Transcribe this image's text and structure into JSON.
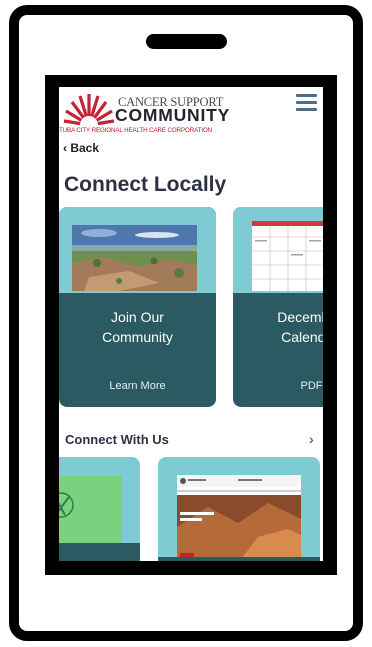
{
  "logo": {
    "line1": "CANCER SUPPORT",
    "line2": "COMMUNITY",
    "line3": "TUBA CITY REGIONAL HEALTH CARE CORPORATION"
  },
  "nav": {
    "back_label": "Back"
  },
  "page": {
    "title": "Connect Locally"
  },
  "cards": [
    {
      "title": "Join Our Community",
      "link": "Learn More"
    },
    {
      "title": "December Calendar",
      "link": "PDF"
    }
  ],
  "section": {
    "title": "Connect With Us"
  },
  "colors": {
    "card_bg": "#2b5a63",
    "card_light": "#7ecbd3",
    "brand_red": "#b31a2c",
    "title_dark": "#2d3142"
  }
}
